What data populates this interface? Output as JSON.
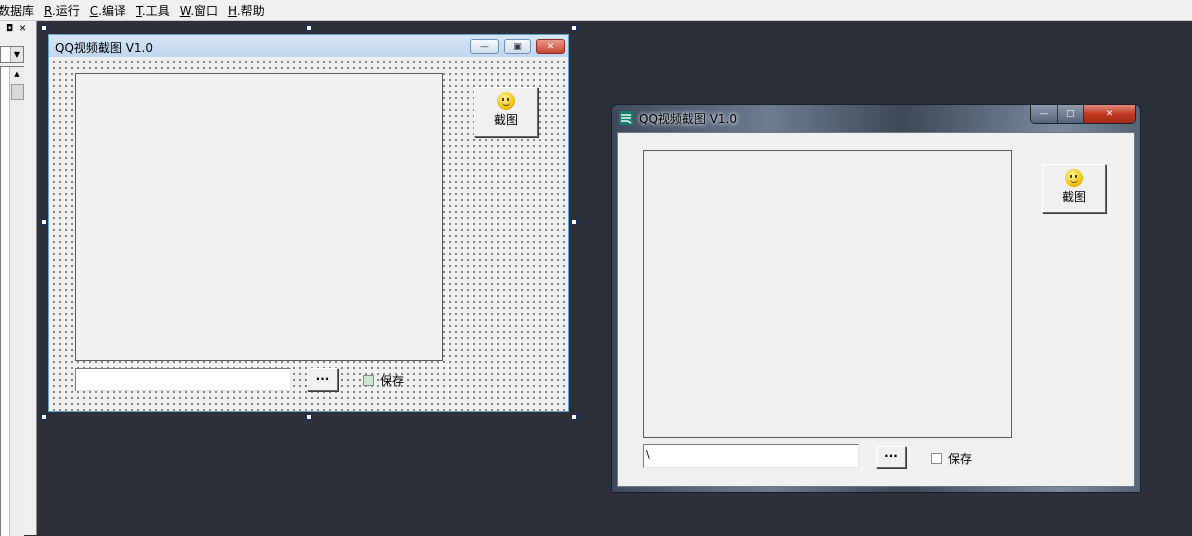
{
  "menubar": {
    "items": [
      {
        "key": "",
        "label": "数据库"
      },
      {
        "key": "R",
        "label": ".运行"
      },
      {
        "key": "C",
        "label": ".编译"
      },
      {
        "key": "T",
        "label": ".工具"
      },
      {
        "key": "W",
        "label": ".窗口"
      },
      {
        "key": "H",
        "label": ".帮助"
      }
    ]
  },
  "left_panel": {
    "restore_glyph": "◘",
    "close_glyph": "✕",
    "combo_arrow": "▼",
    "scroll_up": "▲"
  },
  "designer_form": {
    "title": "QQ视频截图 V1.0",
    "caption_buttons": {
      "minimize": "—",
      "maximize": "▣",
      "close": "✕"
    },
    "capture_button_label": "截图",
    "browse_button_label": "···",
    "path_value": "",
    "save_checkbox": {
      "label": "保存",
      "checked": false
    }
  },
  "preview_window": {
    "title": "QQ视频截图 V1.0",
    "caption_buttons": {
      "minimize": "—",
      "maximize": "□",
      "close": "✕"
    },
    "capture_button_label": "截图",
    "browse_button_label": "···",
    "path_value": "\\",
    "save_checkbox": {
      "label": "保存",
      "checked": false
    }
  },
  "icons": [
    "smiley-icon",
    "app-logo-icon"
  ]
}
